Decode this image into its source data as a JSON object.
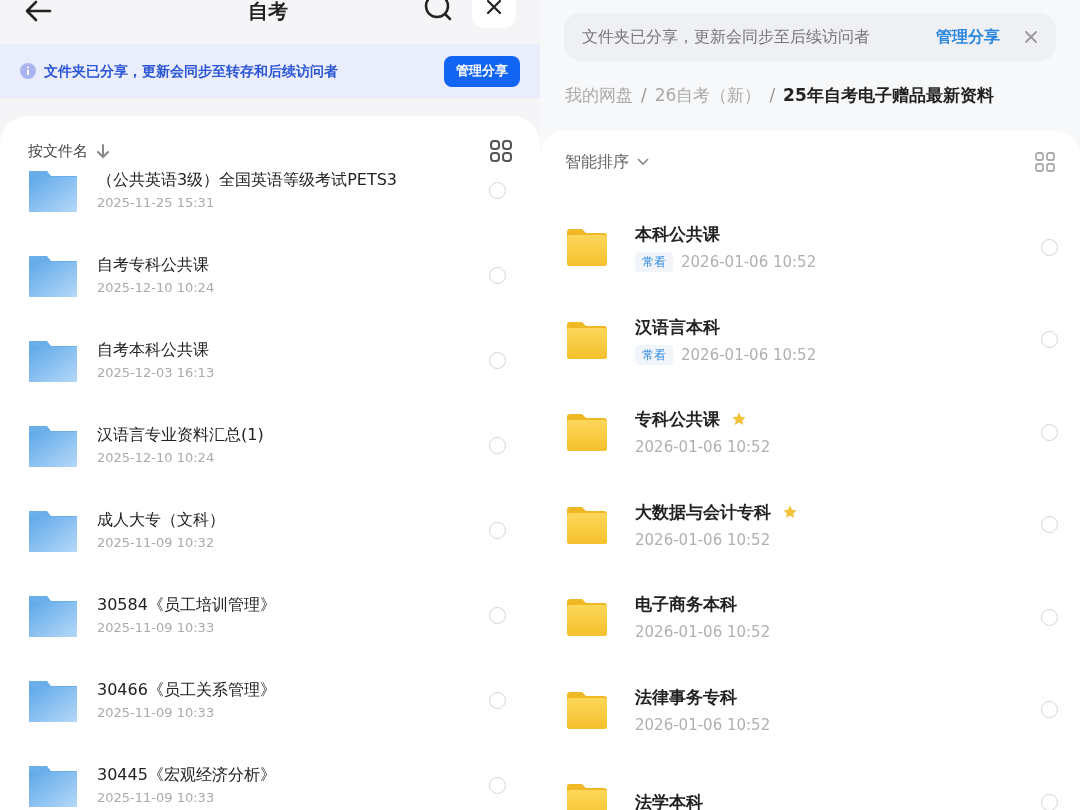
{
  "left": {
    "title": "自考",
    "banner": {
      "text": "文件夹已分享，更新会同步至转存和后续访问者",
      "button": "管理分享"
    },
    "sort_label": "按文件名",
    "rows": [
      {
        "name": "（公共英语3级）全国英语等级考试PETS3",
        "date": "2025-11-25 15:31",
        "selected": false
      },
      {
        "name": "自考专科公共课",
        "date": "2025-12-10 10:24",
        "selected": false
      },
      {
        "name": "自考本科公共课",
        "date": "2025-12-03 16:13",
        "selected": false
      },
      {
        "name": "汉语言专业资料汇总(1)",
        "date": "2025-12-10 10:24",
        "selected": false
      },
      {
        "name": "成人大专（文科）",
        "date": "2025-11-09 10:32",
        "selected": false
      },
      {
        "name": "30584《员工培训管理》",
        "date": "2025-11-09 10:33",
        "selected": false
      },
      {
        "name": "30466《员工关系管理》",
        "date": "2025-11-09 10:33",
        "selected": false
      },
      {
        "name": "30445《宏观经济分析》",
        "date": "2025-11-09 10:33",
        "selected": false
      }
    ]
  },
  "right": {
    "banner": {
      "text": "文件夹已分享，更新会同步至后续访问者",
      "link": "管理分享"
    },
    "breadcrumb_separator": "/",
    "breadcrumb": [
      {
        "label": "我的网盘",
        "current": false
      },
      {
        "label": "26自考（新）",
        "current": false
      },
      {
        "label": "25年自考电子赠品最新资料",
        "current": true
      }
    ],
    "sort_label": "智能排序",
    "rows": [
      {
        "name": "本科公共课",
        "tag": "常看",
        "starred": false,
        "date": "2026-01-06 10:52",
        "selected": false
      },
      {
        "name": "汉语言本科",
        "tag": "常看",
        "starred": false,
        "date": "2026-01-06 10:52",
        "selected": false
      },
      {
        "name": "专科公共课",
        "starred": true,
        "date": "2026-01-06 10:52",
        "selected": false
      },
      {
        "name": "大数据与会计专科",
        "starred": true,
        "date": "2026-01-06 10:52",
        "selected": false
      },
      {
        "name": "电子商务本科",
        "starred": false,
        "date": "2026-01-06 10:52",
        "selected": false
      },
      {
        "name": "法律事务专科",
        "starred": false,
        "date": "2026-01-06 10:52",
        "selected": false
      },
      {
        "name": "法学本科",
        "starred": false,
        "selected": false
      }
    ]
  }
}
